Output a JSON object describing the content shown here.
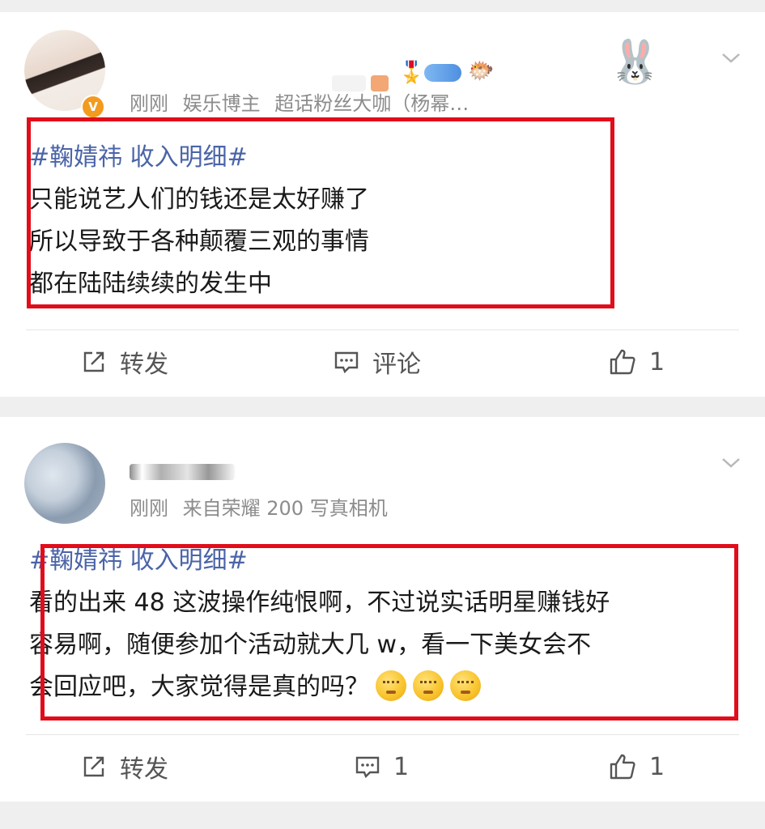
{
  "posts": [
    {
      "meta": {
        "time": "刚刚",
        "role": "娱乐博主",
        "tag": "超话粉丝大咖（杨幂…"
      },
      "topic": "#鞠婧祎 收入明细#",
      "lines": [
        "只能说艺人们的钱还是太好赚了",
        "所以导致于各种颠覆三观的事情",
        "都在陆陆续续的发生中"
      ],
      "actions": {
        "repost_label": "转发",
        "comment_label": "评论",
        "like_count": "1"
      },
      "verified_icon": "orange-v-badge"
    },
    {
      "meta": {
        "time": "刚刚",
        "source": "来自荣耀 200 写真相机"
      },
      "topic": "#鞠婧祎 收入明细#",
      "lines": [
        "看的出来 48 这波操作纯恨啊，不过说实话明星赚钱好",
        "容易啊，随便参加个活动就大几 w，看一下美女会不",
        "会回应吧，大家觉得是真的吗？"
      ],
      "actions": {
        "repost_label": "转发",
        "comment_count": "1",
        "like_count": "1"
      }
    }
  ],
  "colors": {
    "topic": "#4a64a8",
    "highlight_border": "#e10d1a",
    "meta_text": "#8c8c8c",
    "background": "#efefef"
  },
  "icons": [
    "repost-icon",
    "comment-icon",
    "like-icon",
    "chevron-down-icon",
    "thinking-emoji"
  ]
}
